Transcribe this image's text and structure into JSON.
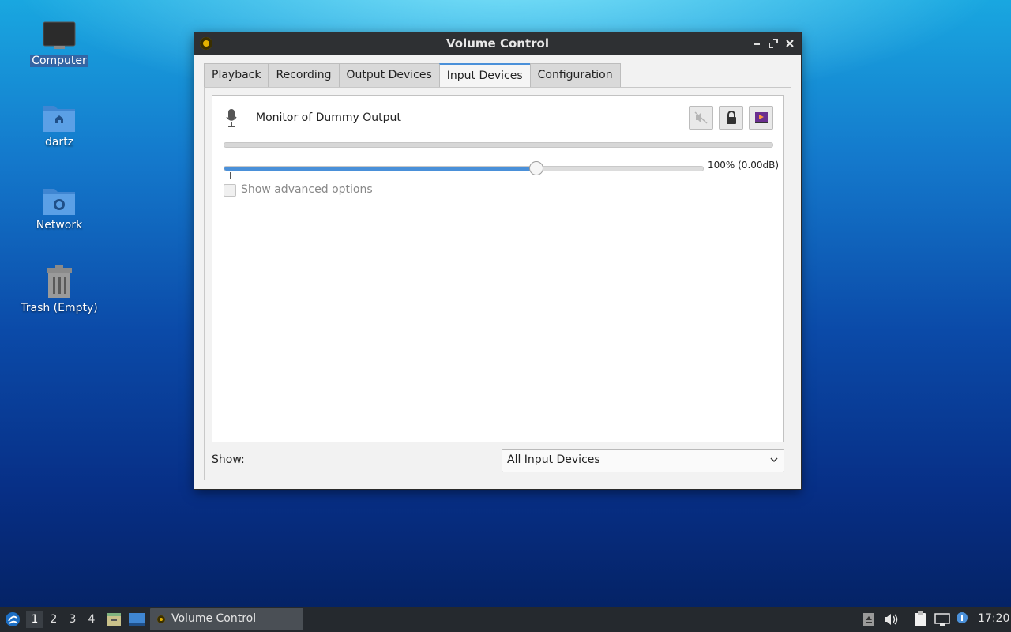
{
  "desktop": {
    "icons": [
      {
        "label": "Computer"
      },
      {
        "label": "dartz"
      },
      {
        "label": "Network"
      },
      {
        "label": "Trash (Empty)"
      }
    ]
  },
  "window": {
    "title": "Volume Control",
    "tabs": [
      {
        "label": "Playback"
      },
      {
        "label": "Recording"
      },
      {
        "label": "Output Devices"
      },
      {
        "label": "Input Devices"
      },
      {
        "label": "Configuration"
      }
    ],
    "active_tab": "Input Devices",
    "device": {
      "name": "Monitor of Dummy Output",
      "volume_text": "100% (0.00dB)",
      "volume_fraction": 0.65,
      "advanced_label": "Show advanced options",
      "advanced_checked": false
    },
    "show_label": "Show:",
    "show_value": "All Input Devices"
  },
  "taskbar": {
    "workspaces": [
      "1",
      "2",
      "3",
      "4"
    ],
    "active_workspace": "1",
    "task_label": "Volume Control",
    "clock": "17:20"
  },
  "colors": {
    "accent": "#4a90d9",
    "titlebar": "#2e3033",
    "taskbar": "#25292e"
  }
}
